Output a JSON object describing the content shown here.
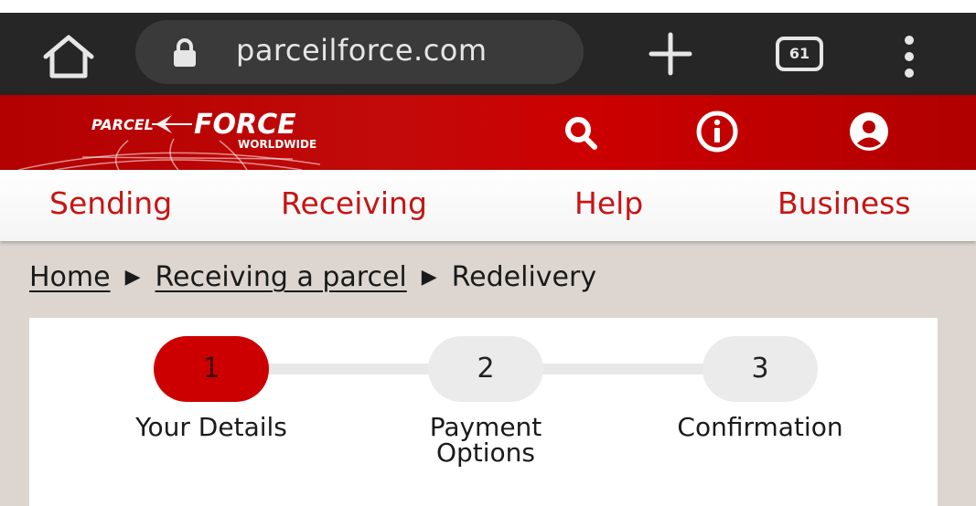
{
  "browser": {
    "url": "parceilforce.com",
    "tab_count": "61"
  },
  "site": {
    "logo_text": "PARCEL FORCE WORLDWIDE",
    "brand_color": "#cc0000"
  },
  "nav": {
    "items": [
      "Sending",
      "Receiving",
      "Help",
      "Business"
    ]
  },
  "breadcrumb": {
    "home": "Home",
    "parent": "Receiving a parcel",
    "current": "Redelivery",
    "separator": "▶"
  },
  "steps": [
    {
      "number": "1",
      "label": "Your Details",
      "active": true
    },
    {
      "number": "2",
      "label": "Payment Options",
      "active": false
    },
    {
      "number": "3",
      "label": "Confirmation",
      "active": false
    }
  ],
  "icons": [
    "home-icon",
    "lock-icon",
    "plus-icon",
    "tabs-icon",
    "more-vert-icon",
    "search-icon",
    "info-icon",
    "account-icon"
  ]
}
